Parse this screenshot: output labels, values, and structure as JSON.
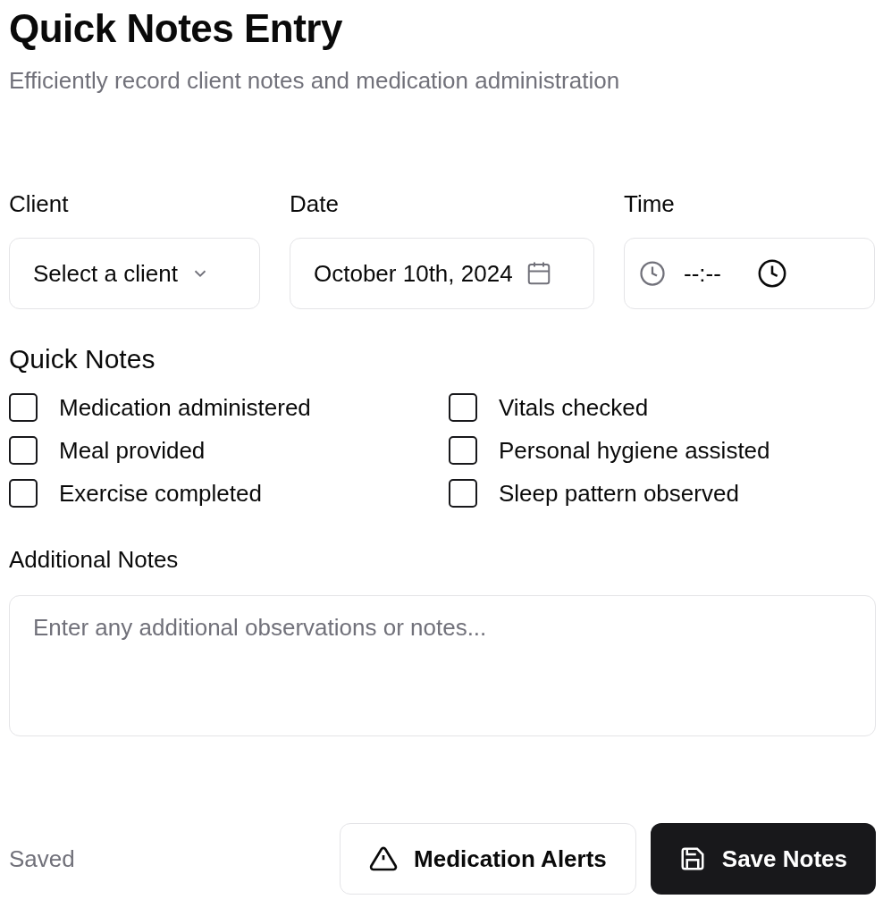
{
  "header": {
    "title": "Quick Notes Entry",
    "subtitle": "Efficiently record client notes and medication administration"
  },
  "fields": {
    "client": {
      "label": "Client",
      "placeholder": "Select a client"
    },
    "date": {
      "label": "Date",
      "value": "October 10th, 2024"
    },
    "time": {
      "label": "Time",
      "value": "--:--"
    }
  },
  "quick_notes": {
    "title": "Quick Notes",
    "items": [
      {
        "label": "Medication administered",
        "checked": false
      },
      {
        "label": "Vitals checked",
        "checked": false
      },
      {
        "label": "Meal provided",
        "checked": false
      },
      {
        "label": "Personal hygiene assisted",
        "checked": false
      },
      {
        "label": "Exercise completed",
        "checked": false
      },
      {
        "label": "Sleep pattern observed",
        "checked": false
      }
    ]
  },
  "additional_notes": {
    "label": "Additional Notes",
    "placeholder": "Enter any additional observations or notes..."
  },
  "footer": {
    "status": "Saved",
    "buttons": [
      {
        "kind": "outline",
        "label": "Medication Alerts"
      },
      {
        "kind": "primary",
        "label": "Save Notes"
      }
    ]
  }
}
